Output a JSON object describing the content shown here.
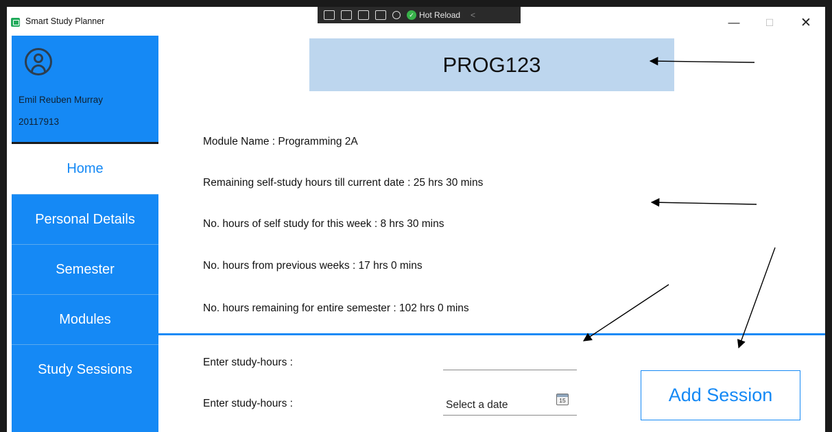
{
  "window": {
    "title": "Smart Study Planner",
    "minimize_glyph": "—",
    "maximize_glyph": "☐",
    "close_glyph": "✕"
  },
  "debug_toolbar": {
    "hot_reload_label": "Hot Reload",
    "collapse_glyph": "<"
  },
  "sidebar": {
    "user_name": "Emil Reuben Murray",
    "user_id": "20117913",
    "items": [
      {
        "label": "Home",
        "active": true
      },
      {
        "label": "Personal Details",
        "active": false
      },
      {
        "label": "Semester",
        "active": false
      },
      {
        "label": "Modules",
        "active": false
      },
      {
        "label": "Study Sessions",
        "active": false
      }
    ]
  },
  "module": {
    "code": "PROG123",
    "info": [
      "Module Name : Programming 2A",
      "Remaining self-study hours till current date : 25 hrs 30 mins",
      "No. hours of self study for this week : 8 hrs 30 mins",
      "No. hours from previous weeks : 17 hrs 0 mins",
      "No. hours remaining for entire semester : 102 hrs 0 mins"
    ]
  },
  "session_form": {
    "hours_label": "Enter study-hours :",
    "hours_value": "",
    "date_label": "Enter study-hours :",
    "date_placeholder": "Select a date",
    "calendar_day": "15",
    "submit_label": "Add Session"
  },
  "colors": {
    "accent": "#1589f5",
    "banner": "#bdd6ee",
    "sidebar_text": "#ffffff"
  }
}
